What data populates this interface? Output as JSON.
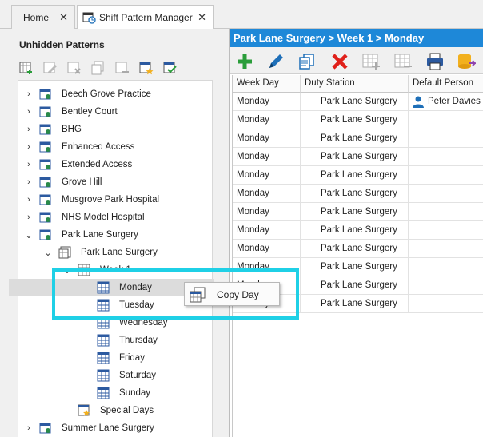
{
  "tabs": [
    {
      "label": "Home",
      "close": "✕"
    },
    {
      "label": "Shift Pattern Manager",
      "close": "✕"
    }
  ],
  "left_panel": {
    "title": "Unhidden Patterns",
    "toolbar": [
      "add-pattern-icon",
      "edit-pattern-icon",
      "delete-pattern-icon",
      "copy-pattern-icon",
      "remove-pattern-icon",
      "calendar-star-icon",
      "calendar-check-icon"
    ],
    "tree": [
      {
        "label": "Beech Grove Practice",
        "level": 0,
        "expander": "›"
      },
      {
        "label": "Bentley Court",
        "level": 0,
        "expander": "›"
      },
      {
        "label": "BHG",
        "level": 0,
        "expander": "›"
      },
      {
        "label": "Enhanced Access",
        "level": 0,
        "expander": "›"
      },
      {
        "label": "Extended Access",
        "level": 0,
        "expander": "›"
      },
      {
        "label": "Grove Hill",
        "level": 0,
        "expander": "›"
      },
      {
        "label": "Musgrove Park Hospital",
        "level": 0,
        "expander": "›"
      },
      {
        "label": "NHS Model Hospital",
        "level": 0,
        "expander": "›"
      },
      {
        "label": "Park Lane Surgery",
        "level": 0,
        "expander": "⌄"
      },
      {
        "label": "Park Lane Surgery",
        "level": 1,
        "expander": "⌄"
      },
      {
        "label": "Week 1",
        "level": 2,
        "expander": "⌄"
      },
      {
        "label": "Monday",
        "level": 3,
        "expander": ""
      },
      {
        "label": "Tuesday",
        "level": 3,
        "expander": ""
      },
      {
        "label": "Wednesday",
        "level": 3,
        "expander": ""
      },
      {
        "label": "Thursday",
        "level": 3,
        "expander": ""
      },
      {
        "label": "Friday",
        "level": 3,
        "expander": ""
      },
      {
        "label": "Saturday",
        "level": 3,
        "expander": ""
      },
      {
        "label": "Sunday",
        "level": 3,
        "expander": ""
      },
      {
        "label": "Special Days",
        "level": 2,
        "expander": ""
      },
      {
        "label": "Summer Lane Surgery",
        "level": 0,
        "expander": "›"
      }
    ]
  },
  "right_panel": {
    "breadcrumb": "Park Lane Surgery > Week 1 > Monday",
    "toolbar": [
      "add-icon",
      "edit-icon",
      "copy-icon",
      "delete-icon",
      "add-row-icon",
      "remove-row-icon",
      "print-icon",
      "database-icon"
    ],
    "columns": [
      "Week Day",
      "Duty Station",
      "Default Person"
    ],
    "rows": [
      {
        "day": "Monday",
        "station": "Park Lane Surgery",
        "person": "Peter Davies"
      },
      {
        "day": "Monday",
        "station": "Park Lane Surgery",
        "person": ""
      },
      {
        "day": "Monday",
        "station": "Park Lane Surgery",
        "person": ""
      },
      {
        "day": "Monday",
        "station": "Park Lane Surgery",
        "person": ""
      },
      {
        "day": "Monday",
        "station": "Park Lane Surgery",
        "person": ""
      },
      {
        "day": "Monday",
        "station": "Park Lane Surgery",
        "person": ""
      },
      {
        "day": "Monday",
        "station": "Park Lane Surgery",
        "person": ""
      },
      {
        "day": "Monday",
        "station": "Park Lane Surgery",
        "person": ""
      },
      {
        "day": "Monday",
        "station": "Park Lane Surgery",
        "person": ""
      },
      {
        "day": "Monday",
        "station": "Park Lane Surgery",
        "person": ""
      },
      {
        "day": "Monday",
        "station": "Park Lane Surgery",
        "person": ""
      },
      {
        "day": "Monday",
        "station": "Park Lane Surgery",
        "person": ""
      }
    ]
  },
  "context_menu": {
    "items": [
      {
        "label": "Copy Day"
      }
    ]
  },
  "colors": {
    "accent": "#1e88d8",
    "highlight": "#1fd0e6"
  }
}
